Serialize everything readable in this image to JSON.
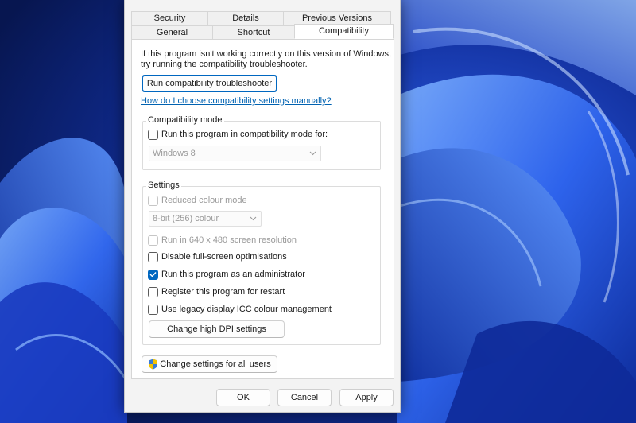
{
  "tabs_row1": [
    {
      "label": "Security"
    },
    {
      "label": "Details"
    },
    {
      "label": "Previous Versions"
    }
  ],
  "tabs_row2": [
    {
      "label": "General"
    },
    {
      "label": "Shortcut"
    },
    {
      "label": "Compatibility"
    }
  ],
  "intro": {
    "line1": "If this program isn't working correctly on this version of Windows,",
    "line2": "try running the compatibility troubleshooter."
  },
  "troubleshooter_button": "Run compatibility troubleshooter",
  "help_link": "How do I choose compatibility settings manually?",
  "compat_mode": {
    "title": "Compatibility mode",
    "checkbox_label": "Run this program in compatibility mode for:",
    "checked": false,
    "selected_os": "Windows 8"
  },
  "settings": {
    "title": "Settings",
    "reduced_colour": {
      "label": "Reduced colour mode",
      "checked": false,
      "disabled": true
    },
    "colour_select": "8-bit (256) colour",
    "res_640": {
      "label": "Run in 640 x 480 screen resolution",
      "checked": false,
      "disabled": true
    },
    "disable_fullscreen": {
      "label": "Disable full-screen optimisations",
      "checked": false
    },
    "run_as_admin": {
      "label": "Run this program as an administrator",
      "checked": true
    },
    "register_restart": {
      "label": "Register this program for restart",
      "checked": false
    },
    "legacy_icc": {
      "label": "Use legacy display ICC colour management",
      "checked": false
    },
    "dpi_button": "Change high DPI settings"
  },
  "all_users_button": "Change settings for all users",
  "footer": {
    "ok": "OK",
    "cancel": "Cancel",
    "apply": "Apply"
  },
  "colors": {
    "accent": "#0067c0",
    "link": "#0062b1",
    "wallpaper_dark": "#0a1a5c",
    "wallpaper_light": "#3f78ff"
  }
}
